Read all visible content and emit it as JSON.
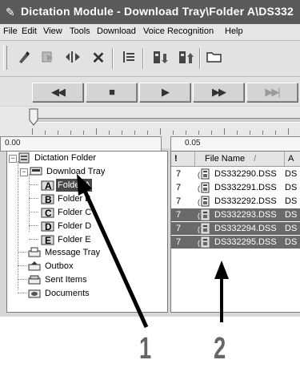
{
  "window": {
    "title": "Dictation Module - Download Tray\\Folder A\\DS332"
  },
  "menu": [
    "File",
    "Edit",
    "View",
    "Tools",
    "Download",
    "Voice Recognition",
    "Help"
  ],
  "toolbar": {
    "icons": [
      "record-icon",
      "play-icon",
      "split-icon",
      "delete-icon",
      "properties-icon",
      "download-icon",
      "upload-icon",
      "folder-icon"
    ]
  },
  "transport": {
    "rewind": "◀◀",
    "stop": "■",
    "play": "▶",
    "fast_forward": "▶▶",
    "skip": "▶▶|"
  },
  "ruler": {
    "start": "0.00",
    "mid": "0.05"
  },
  "tree": {
    "root": "Dictation Folder",
    "download_tray": "Download Tray",
    "folders": [
      {
        "letter": "A",
        "label": "Folder A"
      },
      {
        "letter": "B",
        "label": "Folder B"
      },
      {
        "letter": "C",
        "label": "Folder C"
      },
      {
        "letter": "D",
        "label": "Folder D"
      },
      {
        "letter": "E",
        "label": "Folder E"
      }
    ],
    "message_tray": "Message Tray",
    "outbox": "Outbox",
    "sent_items": "Sent Items",
    "documents": "Documents"
  },
  "list": {
    "headers": {
      "priority": "!",
      "filename": "File Name",
      "sort": "/",
      "next": "A"
    },
    "rows": [
      {
        "priority": "7",
        "name": "DS332290.DSS",
        "col": "DS",
        "selected": false
      },
      {
        "priority": "7",
        "name": "DS332291.DSS",
        "col": "DS",
        "selected": false
      },
      {
        "priority": "7",
        "name": "DS332292.DSS",
        "col": "DS",
        "selected": false
      },
      {
        "priority": "7",
        "name": "DS332293.DSS",
        "col": "DS",
        "selected": true
      },
      {
        "priority": "7",
        "name": "DS332294.DSS",
        "col": "DS",
        "selected": true
      },
      {
        "priority": "7",
        "name": "DS332295.DSS",
        "col": "DS",
        "selected": true
      }
    ]
  },
  "callouts": {
    "one": "1",
    "two": "2"
  }
}
